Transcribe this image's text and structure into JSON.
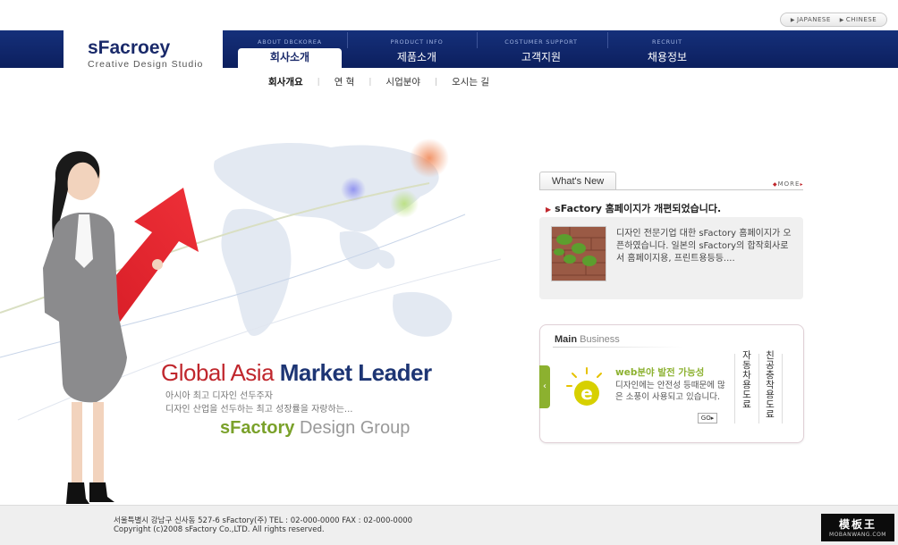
{
  "lang": {
    "items": [
      "JAPANESE",
      "CHINESE"
    ]
  },
  "logo": {
    "title": "sFacroey",
    "subtitle": "Creative Design Studio"
  },
  "nav": {
    "items": [
      {
        "en": "ABOUT DBCKOREA",
        "ko": "회사소개"
      },
      {
        "en": "PRODUCT INFO",
        "ko": "제품소개"
      },
      {
        "en": "COSTUMER SUPPORT",
        "ko": "고객지원"
      },
      {
        "en": "RECRUIT",
        "ko": "채용정보"
      }
    ]
  },
  "subnav": {
    "items": [
      "회사개요",
      "연 혁",
      "시업분야",
      "오시는 길"
    ]
  },
  "hero": {
    "headline_red": "Global Asia",
    "headline_blue": "Market Leader",
    "sub1": "아시아 최고 디자인 선두주자",
    "sub2": "디자인 산업을 선두하는 최고 성장률을 자랑하는...",
    "brand_bold": "sFactory",
    "brand_light": "Design Group"
  },
  "whats_new": {
    "tab": "What's New",
    "more": "MORE",
    "headline": "sFactory 홈페이지가 개편되었습니다.",
    "body": "디자인 전문기업 대한 sFactory 홈페이지가 오픈하였습니다. 일본의 sFactory의 합작회사로서 홈페이지용, 프린트용등등...."
  },
  "main_business": {
    "title_bold": "Main",
    "title_light": "Business",
    "heading": "web분야 발전 가능성",
    "desc": "디자인에는 안전성 등때문에 많은 소풍이 사용되고 있습니다.",
    "go": "GO",
    "vertical1": "자동차용도료",
    "vertical2": "친공충착용도료"
  },
  "footer": {
    "line1": "서울특별시 강남구 신사동 527-6  sFactory(주)    TEL : 02-000-0000    FAX : 02-000-0000",
    "line2": "Copyright (c)2008 sFactory Co.,LTD. All rights reserved."
  },
  "watermark": {
    "title": "模板王",
    "sub": "MOBANWANG.COM"
  },
  "colors": {
    "navy": "#0f2468",
    "red": "#c0272d",
    "green": "#8cb12f"
  }
}
